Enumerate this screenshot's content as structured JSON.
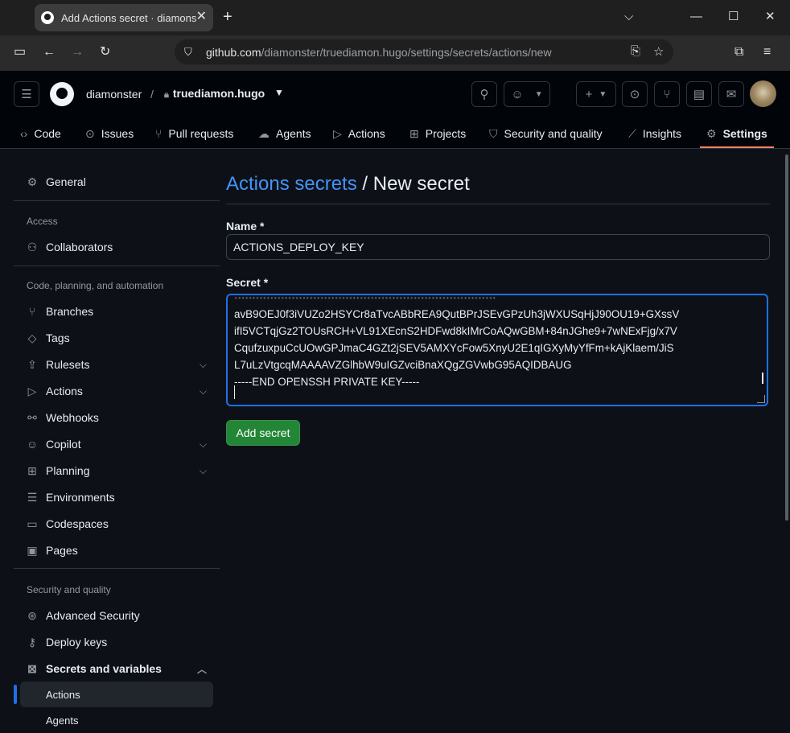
{
  "browser": {
    "tab_title": "Add Actions secret · diamonster/truediamon.hugo",
    "url_host": "github.com",
    "url_path": "/diamonster/truediamon.hugo/settings/secrets/actions/new",
    "icons": [
      "github-favicon",
      "close-icon",
      "plus-icon",
      "chevron-down-icon",
      "minimize-icon",
      "maximize-icon",
      "close-window-icon",
      "sidebar-icon",
      "back-icon",
      "forward-icon",
      "reload-icon",
      "shield-icon",
      "install-icon",
      "star-icon",
      "extensions-icon",
      "menu-icon"
    ]
  },
  "header": {
    "owner": "diamonster",
    "separator": "/",
    "repo": "truediamon.hugo"
  },
  "repo_nav": [
    {
      "label": "Code",
      "icon": "code-icon"
    },
    {
      "label": "Issues",
      "icon": "issue-icon"
    },
    {
      "label": "Pull requests",
      "icon": "pull-request-icon"
    },
    {
      "label": "Agents",
      "icon": "agent-icon"
    },
    {
      "label": "Actions",
      "icon": "play-icon"
    },
    {
      "label": "Projects",
      "icon": "table-icon"
    },
    {
      "label": "Security and quality",
      "icon": "shield-icon"
    },
    {
      "label": "Insights",
      "icon": "graph-icon"
    },
    {
      "label": "Settings",
      "icon": "gear-icon",
      "active": true
    }
  ],
  "sidebar": {
    "general": "General",
    "access_heading": "Access",
    "collaborators": "Collaborators",
    "code_heading": "Code, planning, and automation",
    "branches": "Branches",
    "tags": "Tags",
    "rulesets": "Rulesets",
    "actions": "Actions",
    "webhooks": "Webhooks",
    "copilot": "Copilot",
    "planning": "Planning",
    "environments": "Environments",
    "codespaces": "Codespaces",
    "pages": "Pages",
    "security_heading": "Security and quality",
    "advanced_security": "Advanced Security",
    "deploy_keys": "Deploy keys",
    "secrets_variables": "Secrets and variables",
    "sub_actions": "Actions",
    "sub_agents": "Agents"
  },
  "main": {
    "breadcrumb_link": "Actions secrets",
    "breadcrumb_sep": " / ",
    "title": "New secret",
    "name_label": "Name *",
    "name_value": "ACTIONS_DEPLOY_KEY",
    "secret_label": "Secret *",
    "secret_lines": [
      "avB9OEJ0f3iVUZo2HSYCr8aTvcABbREA9QutBPrJSEvGPzUh3jWXUSqHjJ90OU19+GXssV",
      "ifI5VCTqjGz2TOUsRCH+VL91XEcnS2HDFwd8kIMrCoAQwGBM+84nJGhe9+7wNExFjg/x7V",
      "CqufzuxpuCcUOwGPJmaC4GZt2jSEV5AMXYcFow5XnyU2E1qIGXyMyYfFm+kAjKlaem/JiS",
      "L7uLzVtgcqMAAAAVZGlhbW9uIGZvciBnaXQgZGVwbG95AQIDBAUG",
      "-----END OPENSSH PRIVATE KEY-----"
    ],
    "submit": "Add secret"
  },
  "colors": {
    "accent": "#1f6feb",
    "link": "#4493f8",
    "primary_button": "#238636",
    "active_tab_underline": "#f78166"
  }
}
